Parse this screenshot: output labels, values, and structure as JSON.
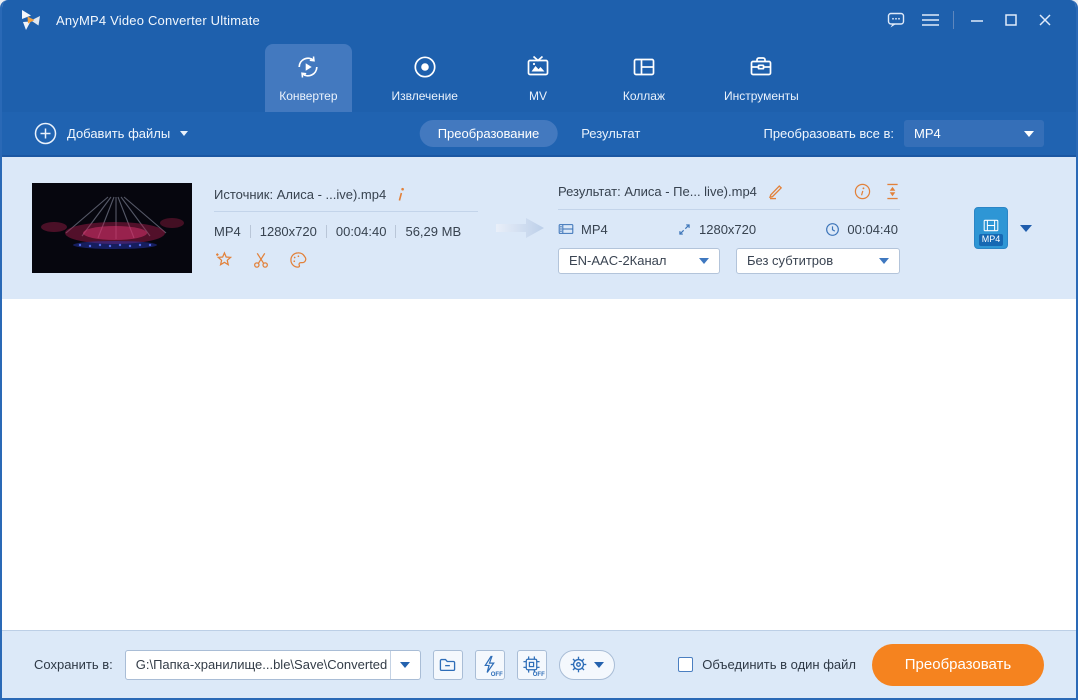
{
  "titlebar": {
    "title": "AnyMP4 Video Converter Ultimate"
  },
  "nav": {
    "tabs": [
      {
        "label": "Конвертер",
        "active": true
      },
      {
        "label": "Извлечение",
        "active": false
      },
      {
        "label": "MV",
        "active": false
      },
      {
        "label": "Коллаж",
        "active": false
      },
      {
        "label": "Инструменты",
        "active": false
      }
    ]
  },
  "toolbar": {
    "add_files_label": "Добавить файлы",
    "view_tabs": [
      {
        "label": "Преобразование",
        "active": true
      },
      {
        "label": "Результат",
        "active": false
      }
    ],
    "convert_all_label": "Преобразовать все в:",
    "convert_all_value": "MP4"
  },
  "file_row": {
    "source": {
      "title": "Источник: Алиса - ...ive).mp4",
      "format": "MP4",
      "resolution": "1280x720",
      "duration": "00:04:40",
      "size": "56,29 MB"
    },
    "output": {
      "title": "Результат: Алиса - Пе... live).mp4",
      "format": "MP4",
      "resolution": "1280x720",
      "duration": "00:04:40",
      "audio_track": "EN-AAC-2Канал",
      "subtitle_track": "Без субтитров",
      "format_badge": "MP4"
    }
  },
  "bottombar": {
    "save_label": "Сохранить в:",
    "save_path": "G:\\Папка-хранилище...ble\\Save\\Converted",
    "hw_off": "OFF",
    "merge_label": "Объединить в один файл",
    "convert_label": "Преобразовать"
  },
  "colors": {
    "header_blue": "#1e60ad",
    "active_tab_blue": "#4379bf",
    "row_bg": "#dbe8f8",
    "accent_orange": "#f5831f",
    "icon_orange": "#e2813a",
    "icon_blue": "#2d6db8",
    "format_btn_blue": "#2e96d5"
  }
}
